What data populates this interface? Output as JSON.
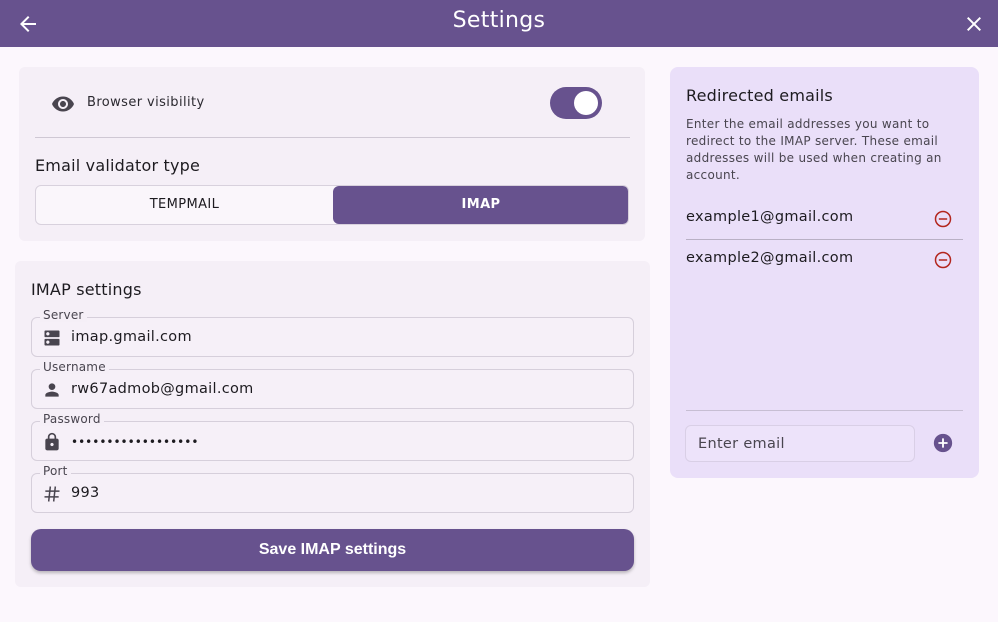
{
  "header": {
    "title": "Settings",
    "back_icon": "arrow-back-icon",
    "close_icon": "close-icon"
  },
  "visibility": {
    "label": "Browser visibility",
    "icon": "eye-icon",
    "enabled": true
  },
  "validator": {
    "title": "Email validator type",
    "options": [
      "TEMPMAIL",
      "IMAP"
    ],
    "selected": "IMAP"
  },
  "imap": {
    "title": "IMAP settings",
    "fields": [
      {
        "label": "Server",
        "value": "imap.gmail.com",
        "icon": "server-icon"
      },
      {
        "label": "Username",
        "value": "rw67admob@gmail.com",
        "icon": "person-icon"
      },
      {
        "label": "Password",
        "value": "••••••••••••••••••",
        "icon": "lock-icon"
      },
      {
        "label": "Port",
        "value": "993",
        "icon": "hash-icon"
      }
    ],
    "save_label": "Save IMAP settings"
  },
  "redirected": {
    "title": "Redirected emails",
    "description": "Enter the email addresses you want to redirect to the IMAP server. These email addresses will be used when creating an account.",
    "emails": [
      "example1@gmail.com",
      "example2@gmail.com"
    ],
    "input_placeholder": "Enter email"
  },
  "colors": {
    "primary": "#67528e",
    "remove": "#b3261e",
    "background": "#fcf7fd"
  }
}
